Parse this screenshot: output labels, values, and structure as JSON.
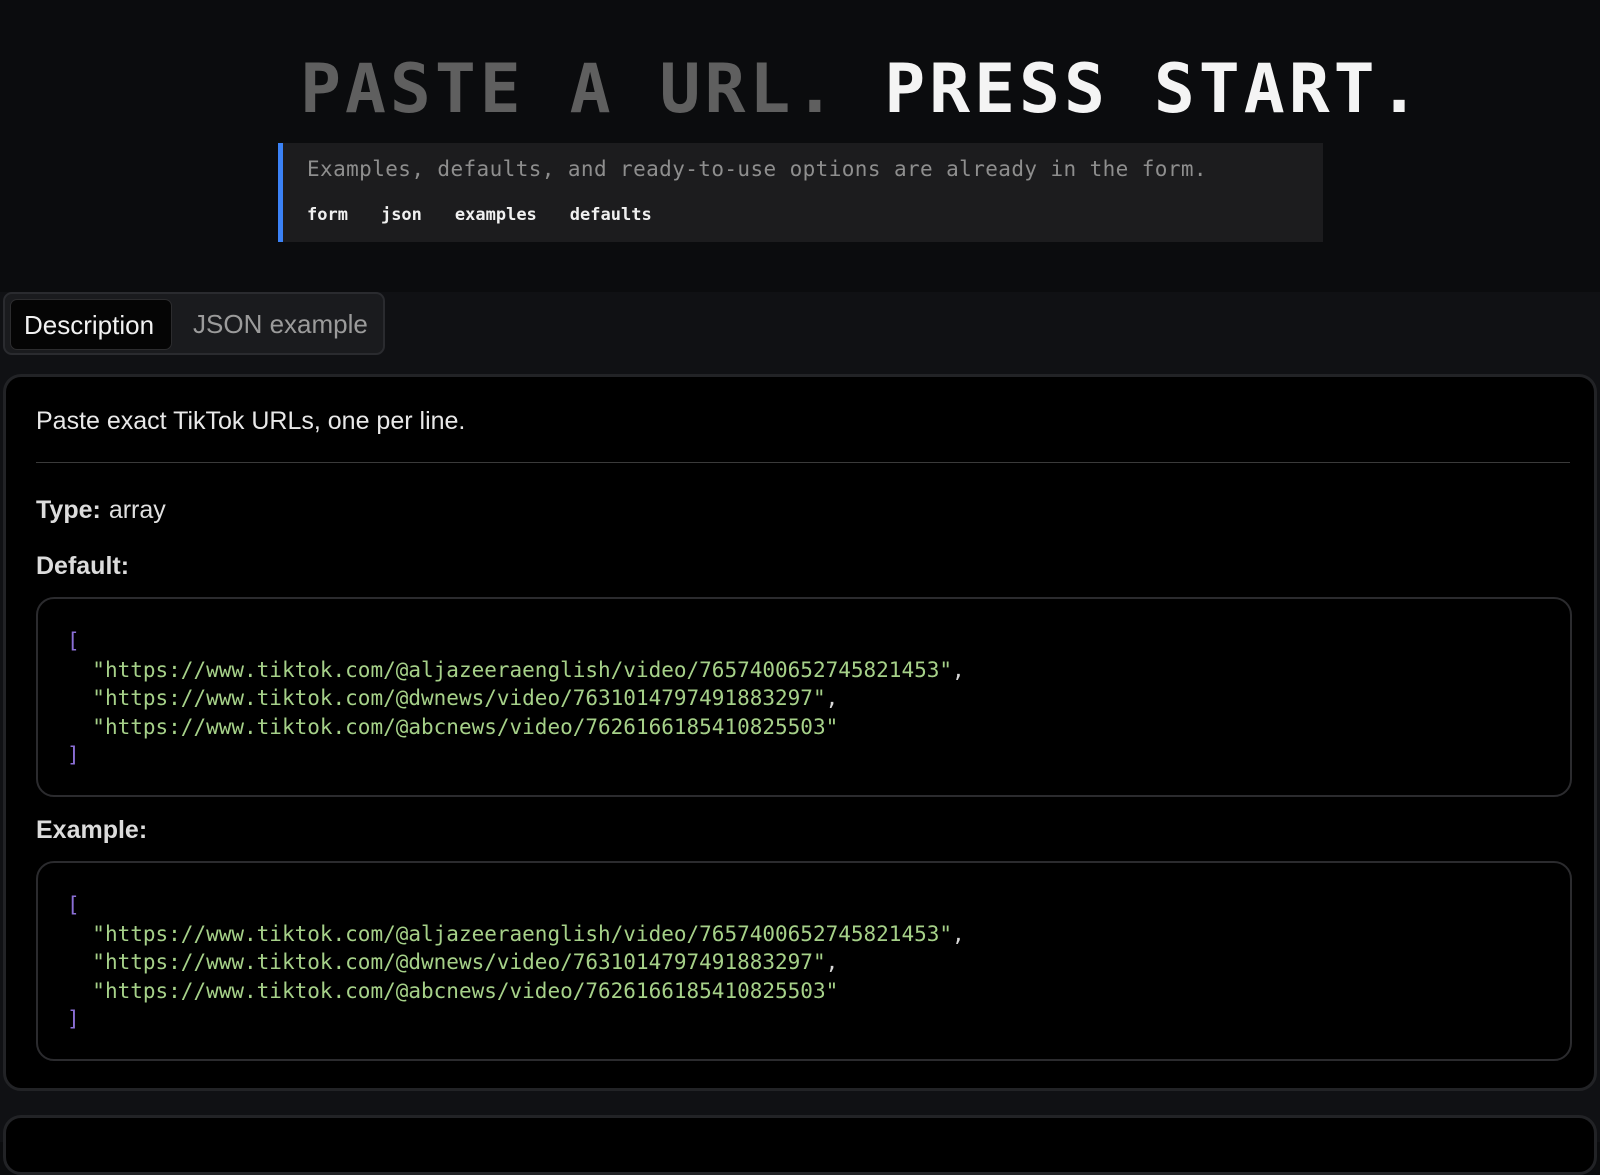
{
  "hero": {
    "headline_dim": "PASTE A URL.",
    "headline_bright": "PRESS START.",
    "note_text": "Examples, defaults, and ready-to-use options are already in the form.",
    "links": [
      "form",
      "json",
      "examples",
      "defaults"
    ],
    "accent_color": "#3b82f6"
  },
  "tabs": {
    "active": "Description",
    "inactive": "JSON example"
  },
  "field": {
    "description": "Paste exact TikTok URLs, one per line.",
    "type_label": "Type:",
    "type_value": "array",
    "default_label": "Default:",
    "example_label": "Example:",
    "default_value": {
      "open": "[",
      "items": [
        "\"https://www.tiktok.com/@aljazeeraenglish/video/7657400652745821453\"",
        "\"https://www.tiktok.com/@dwnews/video/7631014797491883297\"",
        "\"https://www.tiktok.com/@abcnews/video/7626166185410825503\""
      ],
      "close": "]"
    },
    "example_value": {
      "open": "[",
      "items": [
        "\"https://www.tiktok.com/@aljazeeraenglish/video/7657400652745821453\"",
        "\"https://www.tiktok.com/@dwnews/video/7631014797491883297\"",
        "\"https://www.tiktok.com/@abcnews/video/7626166185410825503\""
      ],
      "close": "]"
    }
  }
}
